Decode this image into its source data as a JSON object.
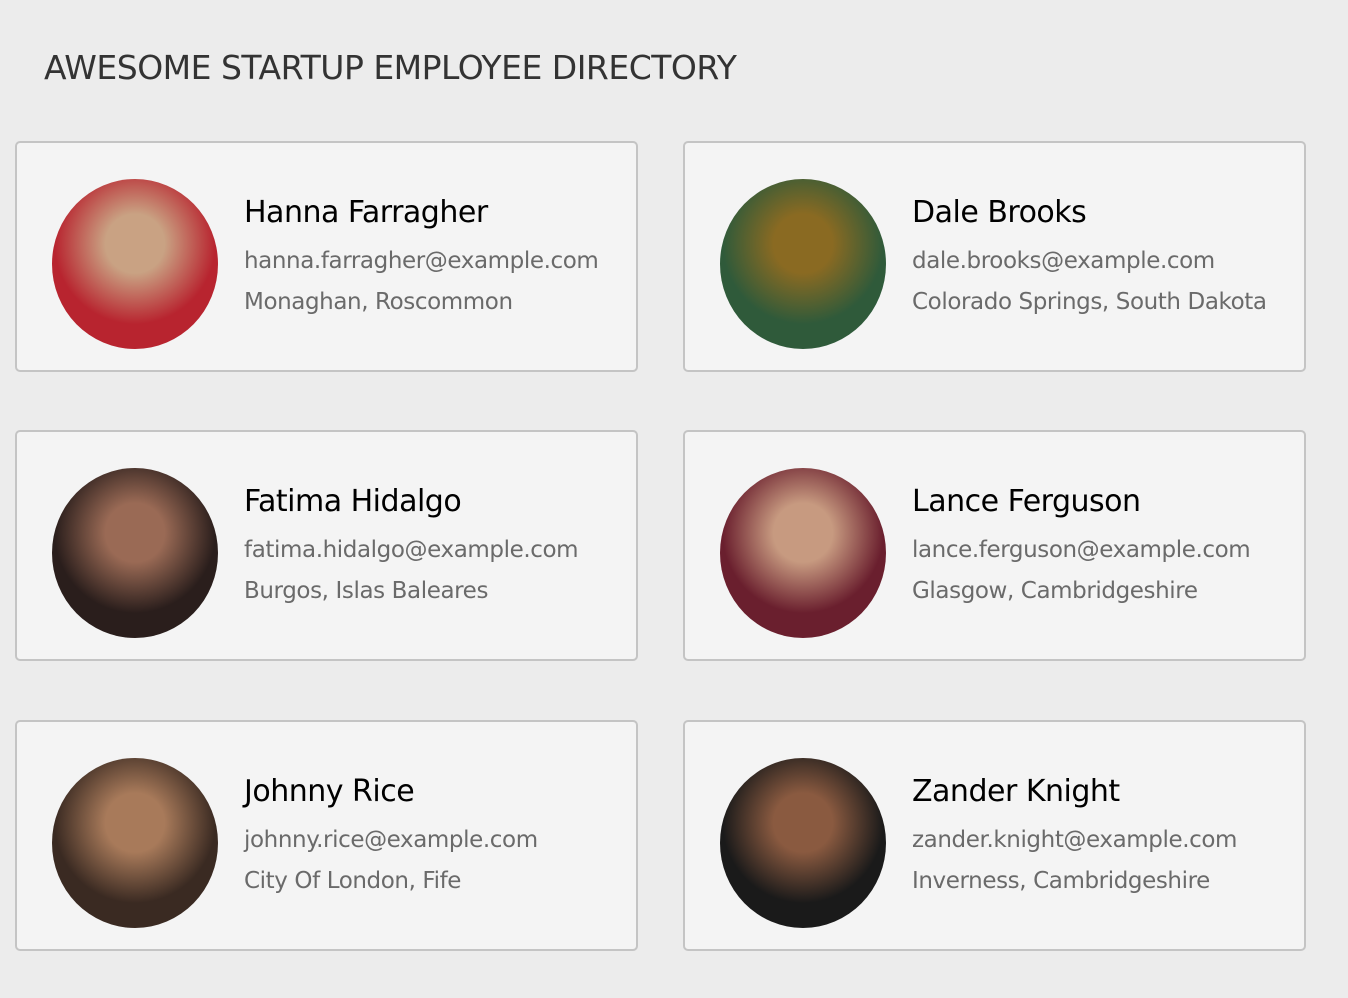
{
  "header": {
    "title": "AWESOME STARTUP EMPLOYEE DIRECTORY"
  },
  "employees": [
    {
      "name": "Hanna Farragher",
      "email": "hanna.farragher@example.com",
      "location": "Monaghan, Roscommon",
      "avatar_colors": [
        "#c9a283",
        "#b8242f"
      ]
    },
    {
      "name": "Dale Brooks",
      "email": "dale.brooks@example.com",
      "location": "Colorado Springs, South Dakota",
      "avatar_colors": [
        "#8a6a22",
        "#2f5a3a"
      ]
    },
    {
      "name": "Fatima Hidalgo",
      "email": "fatima.hidalgo@example.com",
      "location": "Burgos, Islas Baleares",
      "avatar_colors": [
        "#9a6a55",
        "#2a1e1c"
      ]
    },
    {
      "name": "Lance Ferguson",
      "email": "lance.ferguson@example.com",
      "location": "Glasgow, Cambridgeshire",
      "avatar_colors": [
        "#c79a80",
        "#6a1f2e"
      ]
    },
    {
      "name": "Johnny Rice",
      "email": "johnny.rice@example.com",
      "location": "City Of London, Fife",
      "avatar_colors": [
        "#a87a5a",
        "#3a2a22"
      ]
    },
    {
      "name": "Zander Knight",
      "email": "zander.knight@example.com",
      "location": "Inverness, Cambridgeshire",
      "avatar_colors": [
        "#8a5a40",
        "#1a1a1a"
      ]
    }
  ]
}
